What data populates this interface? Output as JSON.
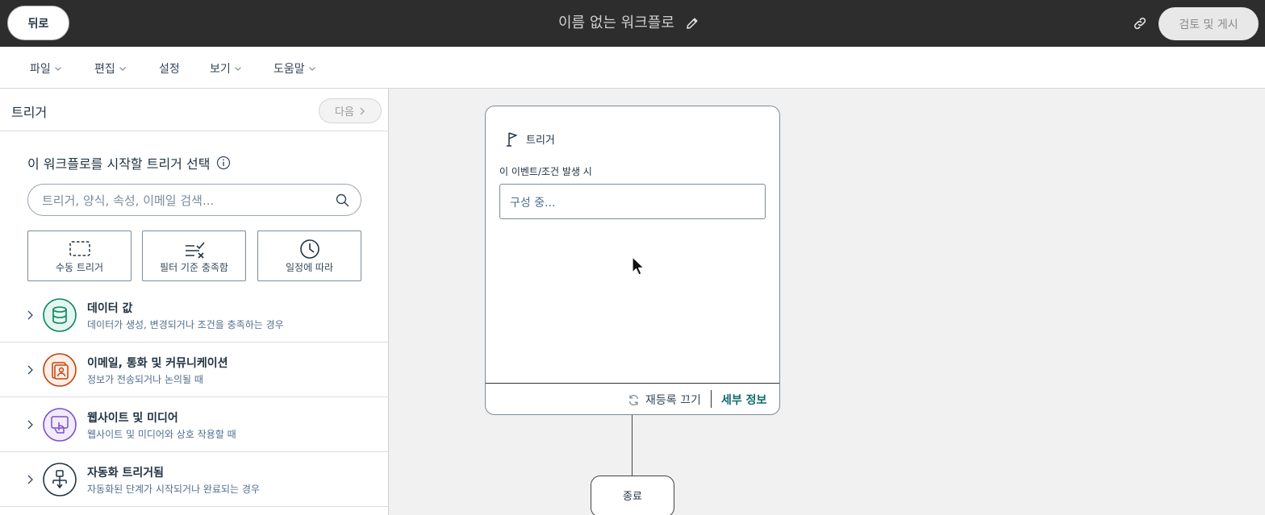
{
  "topbar": {
    "back_label": "뒤로",
    "workflow_title": "이름 없는 워크플로",
    "publish_label": "검토 및 게시",
    "icons": {
      "edit": "pencil-icon",
      "link": "link-icon"
    }
  },
  "menu": {
    "items": [
      {
        "label": "파일",
        "has_dropdown": true
      },
      {
        "label": "편집",
        "has_dropdown": true
      },
      {
        "label": "설정",
        "has_dropdown": false
      },
      {
        "label": "보기",
        "has_dropdown": true
      },
      {
        "label": "도움말",
        "has_dropdown": true
      }
    ]
  },
  "panel": {
    "title": "트리거",
    "next_label": "다음",
    "choose_title": "이 워크플로를 시작할 트리거 선택",
    "search_placeholder": "트리거, 양식, 속성, 이메일 검색...",
    "tiles": [
      {
        "label": "수동 트리거",
        "icon": "dashed-box-icon"
      },
      {
        "label": "필터 기준 충족함",
        "icon": "filter-check-icon"
      },
      {
        "label": "일정에 따라",
        "icon": "clock-icon"
      }
    ],
    "categories": [
      {
        "title": "데이터 값",
        "desc": "데이터가 생성, 변경되거나 조건을 충족하는 경우",
        "icon": "database-icon",
        "color": "#00875a"
      },
      {
        "title": "이메일, 통화 및 커뮤니케이션",
        "desc": "정보가 전송되거나 논의될 때",
        "icon": "contact-card-icon",
        "color": "#c4410c"
      },
      {
        "title": "웹사이트 및 미디어",
        "desc": "웹사이트 및 미디어와 상호 작용할 때",
        "icon": "touch-screen-icon",
        "color": "#7b4fc9"
      },
      {
        "title": "자동화 트리거됨",
        "desc": "자동화된 단계가 시작되거나 완료되는 경우",
        "icon": "workflow-tree-icon",
        "color": "#213343"
      }
    ]
  },
  "canvas": {
    "trigger_card": {
      "header": "트리거",
      "condition_label": "이 이벤트/조건 발생 시",
      "config_text": "구성 중...",
      "reenroll_label": "재등록 끄기",
      "details_label": "세부 정보"
    },
    "end_label": "종료"
  }
}
